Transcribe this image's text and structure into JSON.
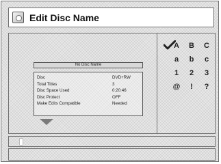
{
  "window": {
    "title": "Edit Disc Name",
    "title_icon": "disc-icon"
  },
  "disc_name_field": {
    "value": "No Disc Name"
  },
  "disc_info": {
    "rows": [
      {
        "label": "Disc",
        "value": "DVD+RW"
      },
      {
        "label": "Total Titles",
        "value": "3"
      },
      {
        "label": "Disc Space Used",
        "value": "0:20:46"
      },
      {
        "label": "Disc Protect",
        "value": "OFF"
      },
      {
        "label": "Make Edits Compatible",
        "value": "Needed"
      }
    ]
  },
  "character_palette": {
    "selected_indicator": "check-icon",
    "rows": [
      [
        "A",
        "B",
        "C"
      ],
      [
        "a",
        "b",
        "c"
      ],
      [
        "1",
        "2",
        "3"
      ],
      [
        "@",
        "!",
        "?"
      ]
    ]
  },
  "colors": {
    "background": "#e9e9e9",
    "border": "#6f6f6f",
    "text": "#222222",
    "title_bar": "#ffffff"
  }
}
